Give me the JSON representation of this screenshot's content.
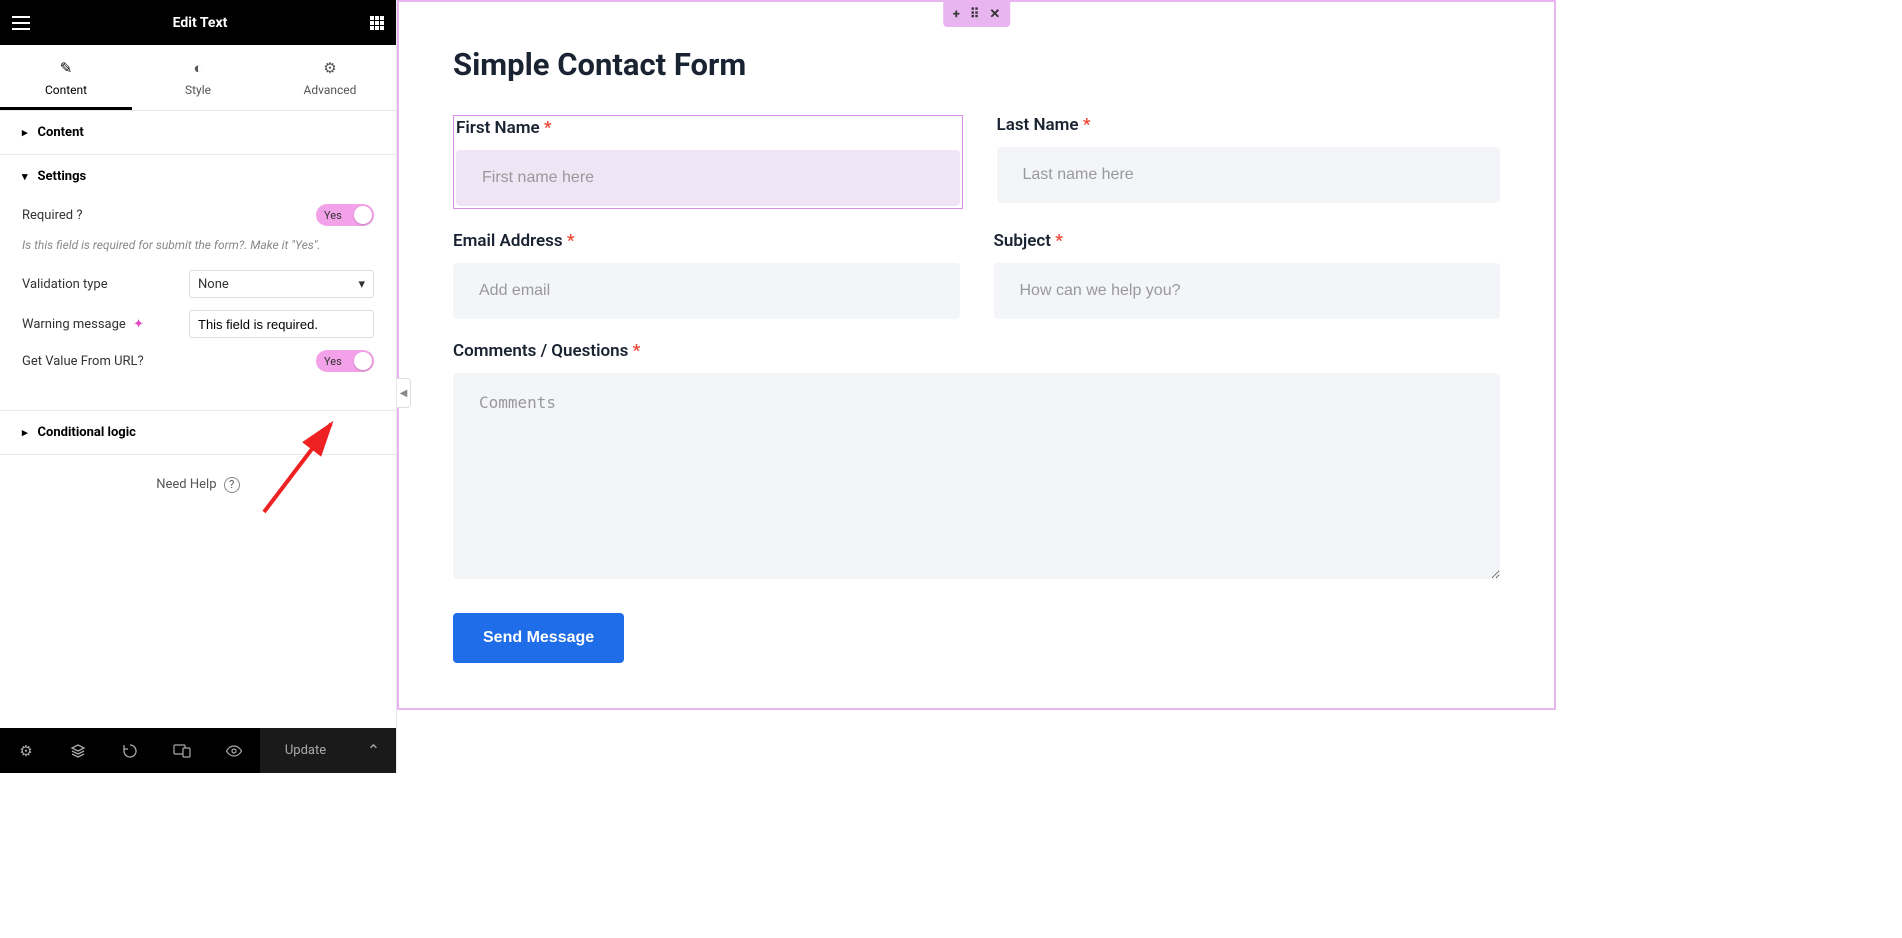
{
  "sidebar": {
    "title": "Edit Text",
    "tabs": [
      {
        "label": "Content",
        "icon": "✎"
      },
      {
        "label": "Style",
        "icon": "◐"
      },
      {
        "label": "Advanced",
        "icon": "⚙"
      }
    ],
    "sections": {
      "content": {
        "label": "Content"
      },
      "settings": {
        "label": "Settings",
        "required_label": "Required ?",
        "required_toggle": "Yes",
        "required_hint": "Is this field is required for submit the form?. Make it \"Yes\".",
        "validation_label": "Validation type",
        "validation_value": "None",
        "warning_label": "Warning message",
        "warning_value": "This field is required.",
        "url_label": "Get Value From URL?",
        "url_toggle": "Yes"
      },
      "conditional": {
        "label": "Conditional logic"
      }
    },
    "need_help": "Need Help",
    "footer": {
      "update": "Update"
    }
  },
  "canvas": {
    "form": {
      "title": "Simple Contact Form",
      "first_name": {
        "label": "First Name",
        "placeholder": "First name here"
      },
      "last_name": {
        "label": "Last Name",
        "placeholder": "Last name here"
      },
      "email": {
        "label": "Email Address",
        "placeholder": "Add email"
      },
      "subject": {
        "label": "Subject",
        "placeholder": "How can we help you?"
      },
      "comments": {
        "label": "Comments / Questions",
        "placeholder": "Comments"
      },
      "submit": "Send Message"
    }
  }
}
